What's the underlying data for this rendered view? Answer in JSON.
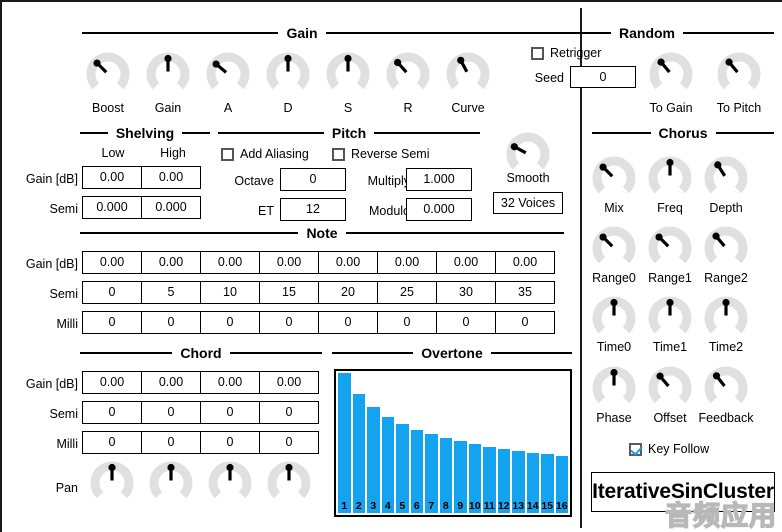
{
  "plugin": {
    "name": "IterativeSinCluster",
    "watermark": "音频应用"
  },
  "colors": {
    "bar": "#14a3ee",
    "knob_arc": "#e0e0e0",
    "pointer": "#000000",
    "check": "#1f9ce4",
    "border": "#000000",
    "background": "#ffffff"
  },
  "gain": {
    "title": "Gain",
    "knobs": [
      {
        "label": "Boost",
        "angle": -45
      },
      {
        "label": "Gain",
        "angle": 0
      },
      {
        "label": "A",
        "angle": -50
      },
      {
        "label": "D",
        "angle": 0
      },
      {
        "label": "S",
        "angle": 0
      },
      {
        "label": "R",
        "angle": -42
      },
      {
        "label": "Curve",
        "angle": -28
      }
    ]
  },
  "random": {
    "title": "Random",
    "retrigger": {
      "label": "Retrigger",
      "checked": false
    },
    "seed": {
      "label": "Seed",
      "value": "0"
    },
    "knobs": [
      {
        "label": "To Gain",
        "angle": -40
      },
      {
        "label": "To Pitch",
        "angle": -40
      }
    ]
  },
  "shelving": {
    "title": "Shelving",
    "columns": [
      "Low",
      "High"
    ],
    "rows": [
      {
        "label": "Gain [dB]",
        "values": [
          "0.00",
          "0.00"
        ]
      },
      {
        "label": "Semi",
        "values": [
          "0.000",
          "0.000"
        ]
      }
    ]
  },
  "pitch": {
    "title": "Pitch",
    "add_aliasing": {
      "label": "Add Aliasing",
      "checked": false
    },
    "reverse_semi": {
      "label": "Reverse Semi",
      "checked": false
    },
    "fields": [
      {
        "label": "Octave",
        "value": "0"
      },
      {
        "label": "Multiply",
        "value": "1.000"
      },
      {
        "label": "ET",
        "value": "12"
      },
      {
        "label": "Modulo",
        "value": "0.000"
      }
    ]
  },
  "smooth": {
    "label": "Smooth",
    "angle": -62,
    "voices": "32 Voices"
  },
  "note": {
    "title": "Note",
    "rows": [
      {
        "label": "Gain [dB]",
        "values": [
          "0.00",
          "0.00",
          "0.00",
          "0.00",
          "0.00",
          "0.00",
          "0.00",
          "0.00"
        ]
      },
      {
        "label": "Semi",
        "values": [
          "0",
          "5",
          "10",
          "15",
          "20",
          "25",
          "30",
          "35"
        ]
      },
      {
        "label": "Milli",
        "values": [
          "0",
          "0",
          "0",
          "0",
          "0",
          "0",
          "0",
          "0"
        ]
      }
    ]
  },
  "chord": {
    "title": "Chord",
    "rows": [
      {
        "label": "Gain [dB]",
        "values": [
          "0.00",
          "0.00",
          "0.00",
          "0.00"
        ]
      },
      {
        "label": "Semi",
        "values": [
          "0",
          "0",
          "0",
          "0"
        ]
      },
      {
        "label": "Milli",
        "values": [
          "0",
          "0",
          "0",
          "0"
        ]
      }
    ],
    "pan": {
      "label": "Pan",
      "knobs": [
        {
          "angle": 0
        },
        {
          "angle": 0
        },
        {
          "angle": 0
        },
        {
          "angle": 0
        }
      ]
    }
  },
  "overtone": {
    "title": "Overtone"
  },
  "chorus": {
    "title": "Chorus",
    "knobs": [
      {
        "label": "Mix",
        "angle": -45
      },
      {
        "label": "Freq",
        "angle": 0
      },
      {
        "label": "Depth",
        "angle": -32
      },
      {
        "label": "Range0",
        "angle": -45
      },
      {
        "label": "Range1",
        "angle": -45
      },
      {
        "label": "Range2",
        "angle": -40
      },
      {
        "label": "Time0",
        "angle": 0
      },
      {
        "label": "Time1",
        "angle": 0
      },
      {
        "label": "Time2",
        "angle": 0
      },
      {
        "label": "Phase",
        "angle": 0
      },
      {
        "label": "Offset",
        "angle": -40
      },
      {
        "label": "Feedback",
        "angle": -38
      }
    ],
    "key_follow": {
      "label": "Key Follow",
      "checked": true
    }
  },
  "chart_data": {
    "type": "bar",
    "title": "Overtone",
    "xlabel": "",
    "ylabel": "",
    "grid": false,
    "legend": null,
    "ylim": [
      0,
      1
    ],
    "categories": [
      "1",
      "2",
      "3",
      "4",
      "5",
      "6",
      "7",
      "8",
      "9",
      "10",
      "11",
      "12",
      "13",
      "14",
      "15",
      "16"
    ],
    "values": [
      1.0,
      0.85,
      0.755,
      0.685,
      0.635,
      0.595,
      0.562,
      0.535,
      0.512,
      0.492,
      0.473,
      0.457,
      0.443,
      0.431,
      0.42,
      0.41
    ]
  }
}
